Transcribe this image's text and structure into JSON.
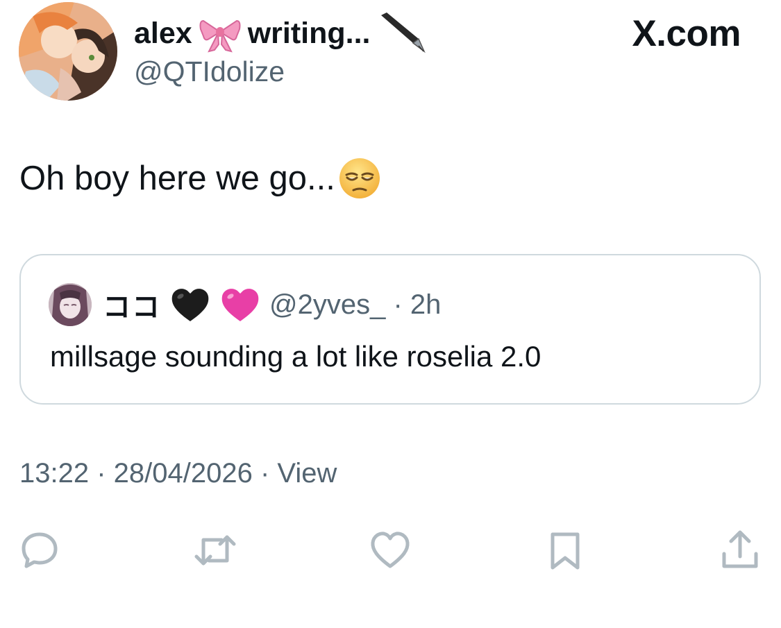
{
  "author": {
    "display_name_part1": "alex",
    "display_name_part2": "writing...",
    "handle": "@QTIdolize",
    "name_emoji": "ribbon-emoji",
    "name_emoji_2": "fountain-pen-emoji"
  },
  "brand": "X.com",
  "tweet": {
    "text": "Oh boy here we go...",
    "emoji": "pensive-face-emoji"
  },
  "quote": {
    "display_name": "ココ",
    "name_emojis": [
      "black-heart-emoji",
      "pink-heart-emoji"
    ],
    "handle_time": "@2yves_ · 2h",
    "text": "millsage sounding a lot like roselia 2.0"
  },
  "meta": {
    "timestamp": "13:22 · 28/04/2026 · View"
  },
  "actions": [
    "reply-icon",
    "retweet-icon",
    "like-icon",
    "bookmark-icon",
    "share-icon"
  ],
  "colors": {
    "text_primary": "#0f1419",
    "text_secondary": "#536471",
    "border": "#cfd9de",
    "icon": "#b0bac1"
  }
}
